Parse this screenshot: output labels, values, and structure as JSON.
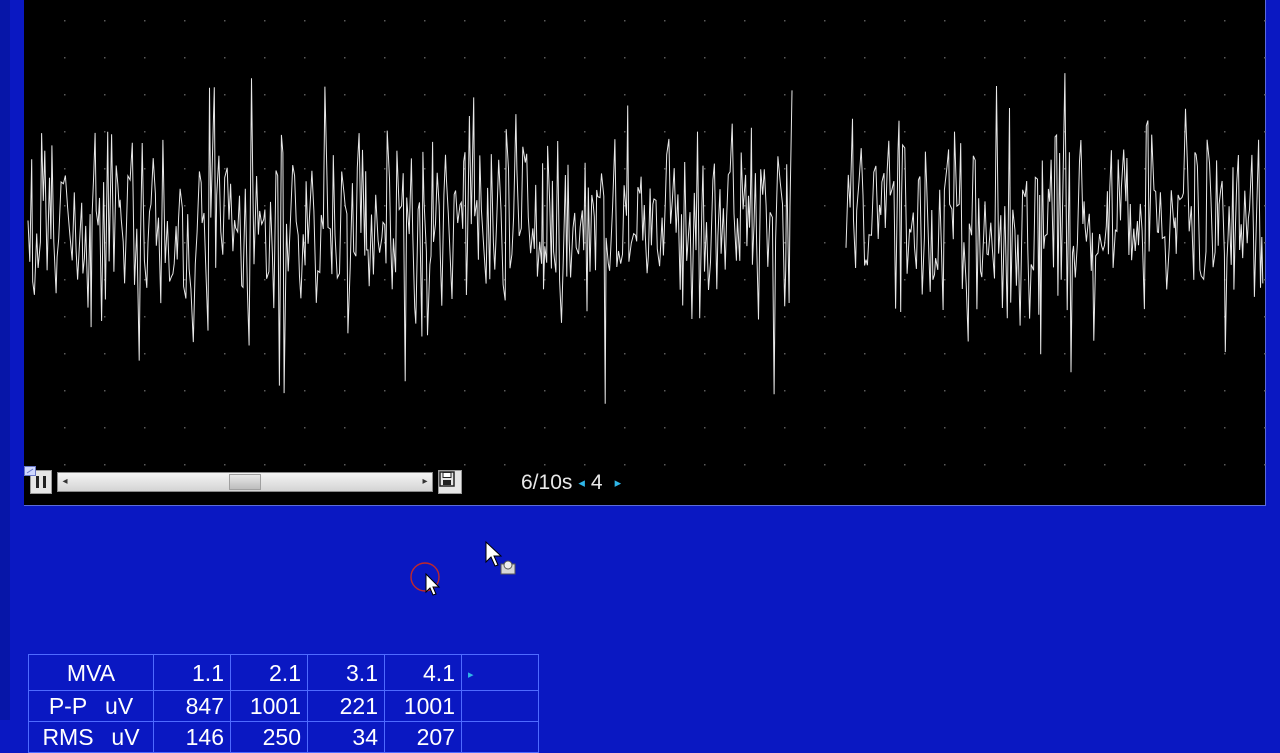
{
  "playback": {
    "time_window": "6/10s",
    "page_number": "4",
    "scroll_position": 0.5
  },
  "table": {
    "header": [
      "MVA",
      "1.1",
      "2.1",
      "3.1",
      "4.1"
    ],
    "rows": [
      {
        "label": "P-P",
        "unit": "uV",
        "values": [
          "847",
          "1001",
          "221",
          "1001"
        ]
      },
      {
        "label": "RMS",
        "unit": "uV",
        "values": [
          "146",
          "250",
          "34",
          "207"
        ]
      }
    ]
  },
  "colors": {
    "background": "#0a18c2",
    "trace": "#e8e8e8",
    "grid_dot": "#5a5a5a",
    "accent_arrow": "#2fb6e8"
  },
  "icons": [
    "pause-icon",
    "save-icon",
    "cursor-arrow-icon",
    "target-circle-icon"
  ]
}
